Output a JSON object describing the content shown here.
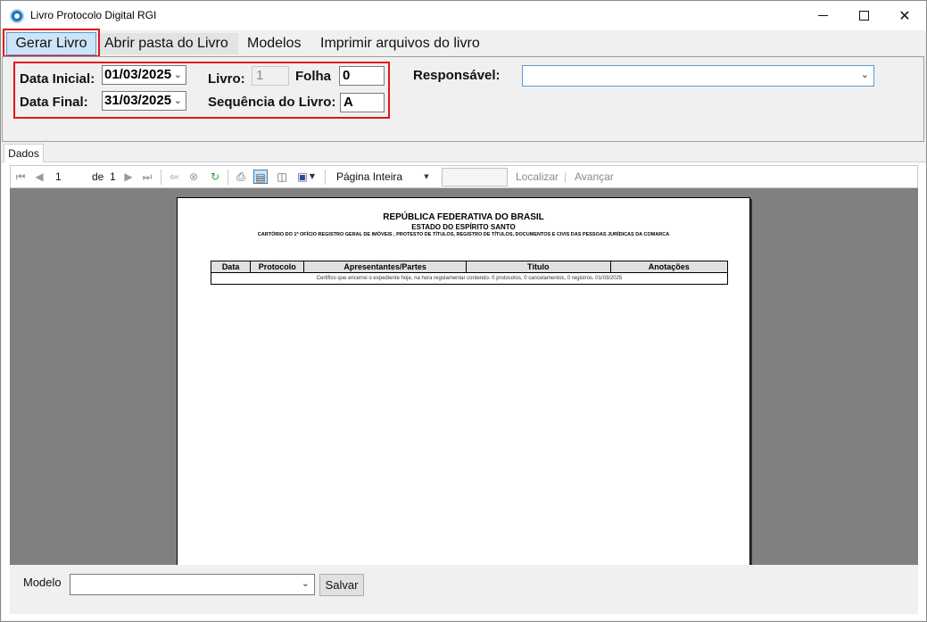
{
  "window": {
    "title": "Livro Protocolo Digital RGI",
    "minimize": "—",
    "maximize": "☐",
    "close": "✕"
  },
  "menu": {
    "items": [
      {
        "label": "Gerar Livro"
      },
      {
        "label": "Abrir pasta do Livro"
      },
      {
        "label": "Modelos"
      },
      {
        "label": "Imprimir arquivos do livro"
      }
    ]
  },
  "form": {
    "data_inicial_label": "Data Inicial:",
    "data_inicial_value": "01/03/2025",
    "data_final_label": "Data Final:",
    "data_final_value": "31/03/2025",
    "livro_label": "Livro:",
    "livro_value": "1",
    "folha_label": "Folha",
    "folha_value": "0",
    "sequencia_label": "Sequência do Livro:",
    "sequencia_value": "A",
    "responsavel_label": "Responsável:",
    "responsavel_value": ""
  },
  "tabs": [
    {
      "label": "Dados"
    }
  ],
  "report_toolbar": {
    "page_current": "1",
    "page_of_label": "de",
    "page_total": "1",
    "zoom_option": "Página Inteira",
    "search_value": "",
    "find_label": "Localizar",
    "next_label": "Avançar",
    "separator": "|"
  },
  "report": {
    "title": "REPÚBLICA FEDERATIVA DO BRASIL",
    "subtitle": "ESTADO DO ESPÍRITO SANTO",
    "office": "CARTÓRIO DO 1º OFÍCIO REGISTRO GERAL DE IMÓVEIS , PROTESTO DE TÍTULOS, REGISTRO DE TÍTULOS, DOCUMENTOS E CIVIS DAS PESSOAS JURÍDICAS DA COMARCA",
    "columns": [
      "Data",
      "Protocolo",
      "Apresentantes/Partes",
      "Título",
      "Anotações"
    ],
    "certificate": "Certifico que encerrei o expediente hoje, na hora regulamentar contendo. 0 protocolos, 0 cancelamentos, 0 registros. 01/03/2025"
  },
  "bottom": {
    "modelo_label": "Modelo",
    "modelo_value": "",
    "save_label": "Salvar"
  }
}
